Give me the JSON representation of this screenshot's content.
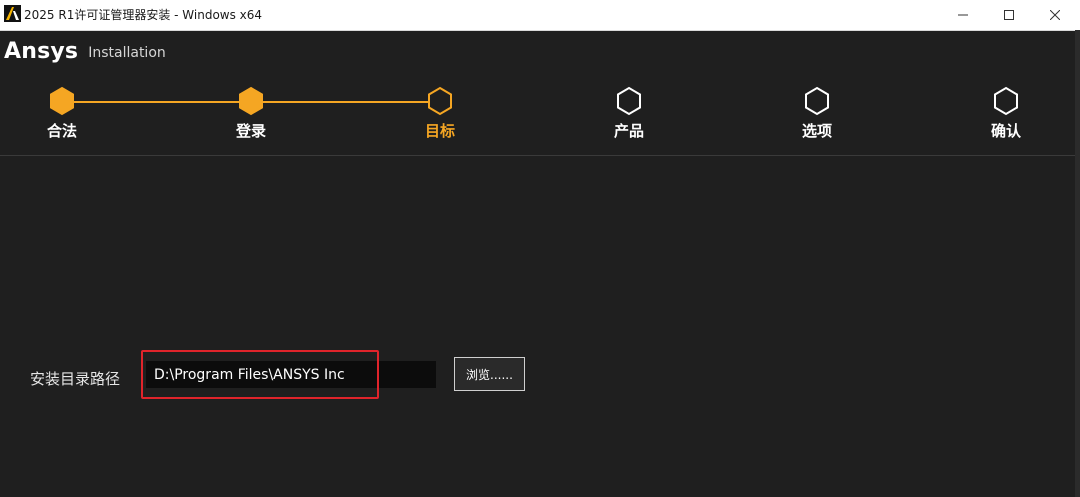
{
  "window": {
    "title": "2025 R1许可证管理器安装 - Windows x64",
    "icon": "ansys-app-icon",
    "controls": [
      "minimize-icon",
      "maximize-icon",
      "close-icon"
    ]
  },
  "header": {
    "brand": "Ansys",
    "subtitle": "Installation"
  },
  "stepper": {
    "completed_color": "#f5a623",
    "pending_color": "#ffffff",
    "steps": [
      {
        "label": "合法",
        "state": "completed"
      },
      {
        "label": "登录",
        "state": "completed"
      },
      {
        "label": "目标",
        "state": "current"
      },
      {
        "label": "产品",
        "state": "pending"
      },
      {
        "label": "选项",
        "state": "pending"
      },
      {
        "label": "确认",
        "state": "pending"
      }
    ]
  },
  "form": {
    "path_label": "安装目录路径",
    "path_value": "D:\\Program Files\\ANSYS Inc",
    "browse_label": "浏览......"
  },
  "colors": {
    "background": "#1f1f1f",
    "accent": "#f5a623",
    "highlight": "#e0242b"
  }
}
